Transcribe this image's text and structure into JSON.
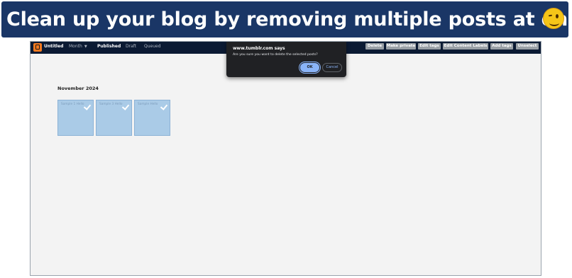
{
  "banner": {
    "caption": "Clean up your blog by removing multiple posts at once",
    "emoji_icon": "winking-face-icon"
  },
  "topbar": {
    "blog_name": "Untitled",
    "nav": {
      "month": "Month",
      "published": "Published",
      "draft": "Draft",
      "queued": "Queued"
    },
    "actions": [
      "Delete",
      "Make private",
      "Edit tags",
      "Edit Content Labels",
      "Add tags",
      "Unselect"
    ]
  },
  "dialog": {
    "title": "www.tumblr.com says",
    "message": "Are you sure you want to delete the selected posts?",
    "ok_label": "OK",
    "cancel_label": "Cancel"
  },
  "content": {
    "month_heading": "November 2024",
    "posts": [
      {
        "label": "Sample 1 Hello",
        "selected": true
      },
      {
        "label": "Sample 3 Hello",
        "selected": true
      },
      {
        "label": "Sample Hello",
        "selected": true
      }
    ]
  },
  "colors": {
    "banner_bg": "#1a3666",
    "topbar_bg": "#0b1a33",
    "post_selected_bg": "#aacbe7",
    "dialog_bg": "#202124",
    "ok_button": "#8ab4f8"
  }
}
